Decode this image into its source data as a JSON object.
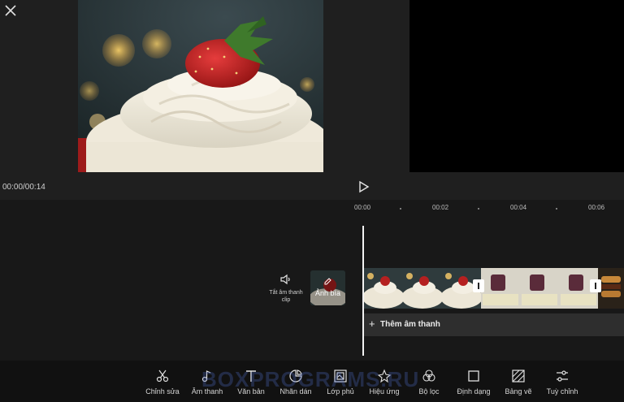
{
  "header": {
    "close_icon": "close-icon"
  },
  "preview": {
    "time": "00:00/00:14",
    "play_icon": "play-icon"
  },
  "ruler": {
    "ticks": [
      "00:00",
      "00:02",
      "00:04",
      "00:06"
    ]
  },
  "timeline": {
    "mute": {
      "icon": "speaker-icon",
      "label": "Tắt âm thanh clip"
    },
    "cover": {
      "icon": "edit-icon",
      "label": "Ảnh bìa"
    },
    "add_audio": {
      "icon": "plus-icon",
      "label": "Thêm âm thanh"
    }
  },
  "watermark": {
    "text": "BOXPROGRAMS.RU"
  },
  "toolbar": {
    "items": [
      {
        "label": "Chỉnh sửa",
        "icon": "scissors-icon"
      },
      {
        "label": "Âm thanh",
        "icon": "music-note-icon"
      },
      {
        "label": "Văn bản",
        "icon": "text-icon"
      },
      {
        "label": "Nhãn dán",
        "icon": "sticker-icon"
      },
      {
        "label": "Lớp phủ",
        "icon": "overlay-icon"
      },
      {
        "label": "Hiệu ứng",
        "icon": "sparkle-icon"
      },
      {
        "label": "Bộ lọc",
        "icon": "filter-icon"
      },
      {
        "label": "Định dạng",
        "icon": "format-icon"
      },
      {
        "label": "Bảng vẽ",
        "icon": "canvas-icon"
      },
      {
        "label": "Tuỳ chỉnh",
        "icon": "adjust-icon"
      }
    ]
  }
}
